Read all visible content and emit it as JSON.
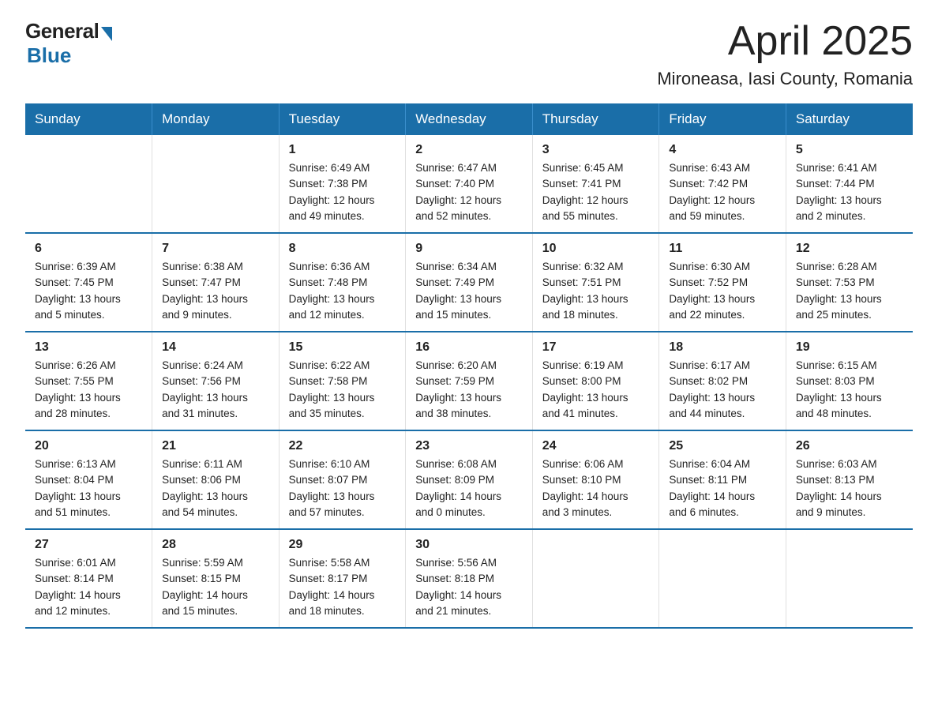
{
  "header": {
    "logo_general": "General",
    "logo_blue": "Blue",
    "title": "April 2025",
    "location": "Mironeasa, Iasi County, Romania"
  },
  "days_of_week": [
    "Sunday",
    "Monday",
    "Tuesday",
    "Wednesday",
    "Thursday",
    "Friday",
    "Saturday"
  ],
  "weeks": [
    [
      {
        "day": "",
        "info": ""
      },
      {
        "day": "",
        "info": ""
      },
      {
        "day": "1",
        "info": "Sunrise: 6:49 AM\nSunset: 7:38 PM\nDaylight: 12 hours\nand 49 minutes."
      },
      {
        "day": "2",
        "info": "Sunrise: 6:47 AM\nSunset: 7:40 PM\nDaylight: 12 hours\nand 52 minutes."
      },
      {
        "day": "3",
        "info": "Sunrise: 6:45 AM\nSunset: 7:41 PM\nDaylight: 12 hours\nand 55 minutes."
      },
      {
        "day": "4",
        "info": "Sunrise: 6:43 AM\nSunset: 7:42 PM\nDaylight: 12 hours\nand 59 minutes."
      },
      {
        "day": "5",
        "info": "Sunrise: 6:41 AM\nSunset: 7:44 PM\nDaylight: 13 hours\nand 2 minutes."
      }
    ],
    [
      {
        "day": "6",
        "info": "Sunrise: 6:39 AM\nSunset: 7:45 PM\nDaylight: 13 hours\nand 5 minutes."
      },
      {
        "day": "7",
        "info": "Sunrise: 6:38 AM\nSunset: 7:47 PM\nDaylight: 13 hours\nand 9 minutes."
      },
      {
        "day": "8",
        "info": "Sunrise: 6:36 AM\nSunset: 7:48 PM\nDaylight: 13 hours\nand 12 minutes."
      },
      {
        "day": "9",
        "info": "Sunrise: 6:34 AM\nSunset: 7:49 PM\nDaylight: 13 hours\nand 15 minutes."
      },
      {
        "day": "10",
        "info": "Sunrise: 6:32 AM\nSunset: 7:51 PM\nDaylight: 13 hours\nand 18 minutes."
      },
      {
        "day": "11",
        "info": "Sunrise: 6:30 AM\nSunset: 7:52 PM\nDaylight: 13 hours\nand 22 minutes."
      },
      {
        "day": "12",
        "info": "Sunrise: 6:28 AM\nSunset: 7:53 PM\nDaylight: 13 hours\nand 25 minutes."
      }
    ],
    [
      {
        "day": "13",
        "info": "Sunrise: 6:26 AM\nSunset: 7:55 PM\nDaylight: 13 hours\nand 28 minutes."
      },
      {
        "day": "14",
        "info": "Sunrise: 6:24 AM\nSunset: 7:56 PM\nDaylight: 13 hours\nand 31 minutes."
      },
      {
        "day": "15",
        "info": "Sunrise: 6:22 AM\nSunset: 7:58 PM\nDaylight: 13 hours\nand 35 minutes."
      },
      {
        "day": "16",
        "info": "Sunrise: 6:20 AM\nSunset: 7:59 PM\nDaylight: 13 hours\nand 38 minutes."
      },
      {
        "day": "17",
        "info": "Sunrise: 6:19 AM\nSunset: 8:00 PM\nDaylight: 13 hours\nand 41 minutes."
      },
      {
        "day": "18",
        "info": "Sunrise: 6:17 AM\nSunset: 8:02 PM\nDaylight: 13 hours\nand 44 minutes."
      },
      {
        "day": "19",
        "info": "Sunrise: 6:15 AM\nSunset: 8:03 PM\nDaylight: 13 hours\nand 48 minutes."
      }
    ],
    [
      {
        "day": "20",
        "info": "Sunrise: 6:13 AM\nSunset: 8:04 PM\nDaylight: 13 hours\nand 51 minutes."
      },
      {
        "day": "21",
        "info": "Sunrise: 6:11 AM\nSunset: 8:06 PM\nDaylight: 13 hours\nand 54 minutes."
      },
      {
        "day": "22",
        "info": "Sunrise: 6:10 AM\nSunset: 8:07 PM\nDaylight: 13 hours\nand 57 minutes."
      },
      {
        "day": "23",
        "info": "Sunrise: 6:08 AM\nSunset: 8:09 PM\nDaylight: 14 hours\nand 0 minutes."
      },
      {
        "day": "24",
        "info": "Sunrise: 6:06 AM\nSunset: 8:10 PM\nDaylight: 14 hours\nand 3 minutes."
      },
      {
        "day": "25",
        "info": "Sunrise: 6:04 AM\nSunset: 8:11 PM\nDaylight: 14 hours\nand 6 minutes."
      },
      {
        "day": "26",
        "info": "Sunrise: 6:03 AM\nSunset: 8:13 PM\nDaylight: 14 hours\nand 9 minutes."
      }
    ],
    [
      {
        "day": "27",
        "info": "Sunrise: 6:01 AM\nSunset: 8:14 PM\nDaylight: 14 hours\nand 12 minutes."
      },
      {
        "day": "28",
        "info": "Sunrise: 5:59 AM\nSunset: 8:15 PM\nDaylight: 14 hours\nand 15 minutes."
      },
      {
        "day": "29",
        "info": "Sunrise: 5:58 AM\nSunset: 8:17 PM\nDaylight: 14 hours\nand 18 minutes."
      },
      {
        "day": "30",
        "info": "Sunrise: 5:56 AM\nSunset: 8:18 PM\nDaylight: 14 hours\nand 21 minutes."
      },
      {
        "day": "",
        "info": ""
      },
      {
        "day": "",
        "info": ""
      },
      {
        "day": "",
        "info": ""
      }
    ]
  ]
}
